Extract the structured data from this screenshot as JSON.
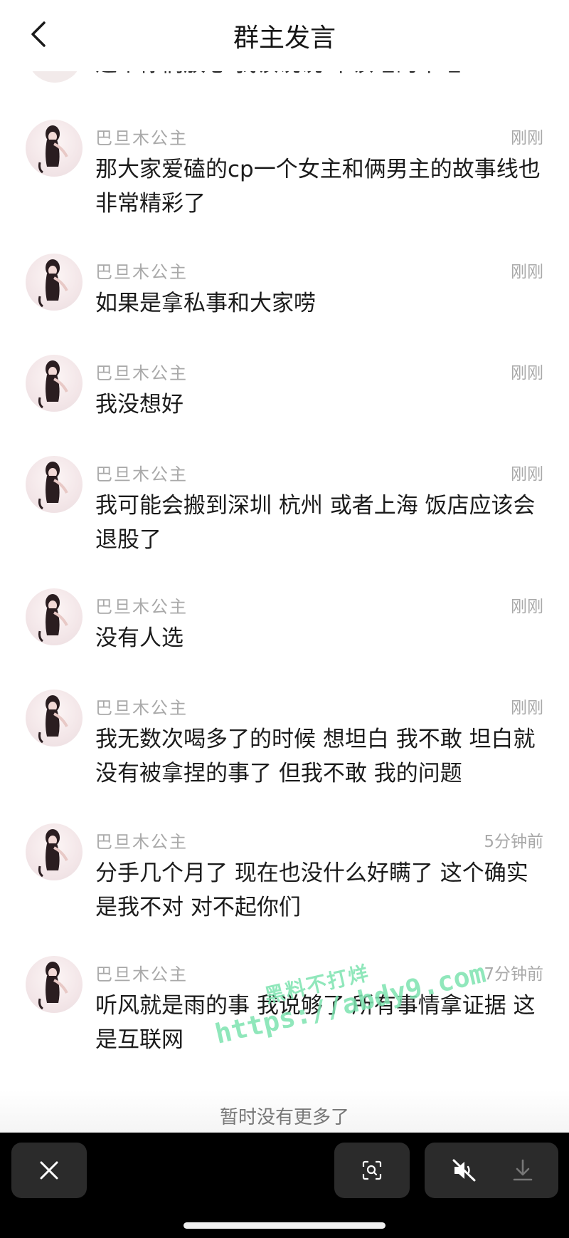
{
  "header": {
    "title": "群主发言"
  },
  "partial_message": {
    "text": "这个你们放心 我该说说 不该睡的不睡"
  },
  "messages": [
    {
      "name": "巴旦木公主",
      "time": "刚刚",
      "text": "那大家爱磕的cp一个女主和俩男主的故事线也非常精彩了"
    },
    {
      "name": "巴旦木公主",
      "time": "刚刚",
      "text": "如果是拿私事和大家唠"
    },
    {
      "name": "巴旦木公主",
      "time": "刚刚",
      "text": "我没想好"
    },
    {
      "name": "巴旦木公主",
      "time": "刚刚",
      "text": "我可能会搬到深圳 杭州 或者上海 饭店应该会退股了"
    },
    {
      "name": "巴旦木公主",
      "time": "刚刚",
      "text": "没有人选"
    },
    {
      "name": "巴旦木公主",
      "time": "刚刚",
      "text": "我无数次喝多了的时候 想坦白 我不敢 坦白就没有被拿捏的事了 但我不敢 我的问题"
    },
    {
      "name": "巴旦木公主",
      "time": "5分钟前",
      "text": "分手几个月了 现在也没什么好瞒了 这个确实是我不对 对不起你们"
    },
    {
      "name": "巴旦木公主",
      "time": "7分钟前",
      "text": "听风就是雨的事 我说够了 所有事情拿证据 这是互联网"
    }
  ],
  "footer": {
    "no_more": "暂时没有更多了"
  },
  "watermark": {
    "line1": "黑料不打烊",
    "line2": "https://abdy9.com"
  },
  "toolbar": {
    "icons": [
      "close-icon",
      "scan-icon",
      "mute-icon",
      "download-icon"
    ]
  },
  "colors": {
    "toolbar_bg": "#000000",
    "button_bg": "#2b2b2b",
    "meta_text": "#a9a9a9",
    "watermark": "#7de3b0"
  }
}
